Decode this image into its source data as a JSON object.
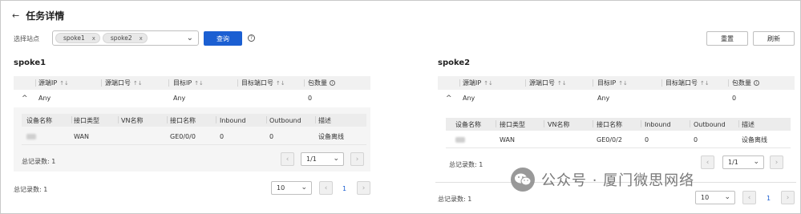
{
  "header": {
    "back_icon": "arrow-left-icon",
    "title": "任务详情"
  },
  "filter": {
    "label": "选择站点",
    "tags": [
      {
        "text": "spoke1",
        "x": "x"
      },
      {
        "text": "spoke2",
        "x": "x"
      }
    ],
    "query_label": "查询",
    "help_glyph": "?",
    "reset_label": "重置",
    "refresh_label": "刷新"
  },
  "columns": {
    "src_ip": "源端IP",
    "src_port": "源端口号",
    "dst_ip": "目标IP",
    "dst_port": "目标端口号",
    "packets": "包数量",
    "sort_glyph": "↑↓",
    "info_glyph": "i"
  },
  "sub_columns": {
    "device": "设备名称",
    "if_type": "接口类型",
    "vn": "VN名称",
    "if_name": "接口名称",
    "inbound": "Inbound",
    "outbound": "Outbound",
    "desc": "描述"
  },
  "panels": [
    {
      "title": "spoke1",
      "row": {
        "src_ip": "Any",
        "dst_ip": "Any",
        "packets": "0"
      },
      "sub_row": {
        "if_type": "WAN",
        "vn": "",
        "if_name": "GE0/0/0",
        "inbound": "0",
        "outbound": "0",
        "desc": "设备离线"
      },
      "sub_total": "总记录数: 1",
      "sub_page": "1/1",
      "total": "总记录数: 1",
      "page_size": "10",
      "page_num": "1"
    },
    {
      "title": "spoke2",
      "row": {
        "src_ip": "Any",
        "dst_ip": "Any",
        "packets": "0"
      },
      "sub_row": {
        "if_type": "WAN",
        "vn": "",
        "if_name": "GE0/0/2",
        "inbound": "0",
        "outbound": "0",
        "desc": "设备离线"
      },
      "sub_total": "总记录数: 1",
      "sub_page": "1/1",
      "total": "总记录数: 1",
      "page_size": "10",
      "page_num": "1"
    }
  ],
  "pager_glyphs": {
    "prev": "‹",
    "next": "›",
    "chevron": "⌄"
  },
  "watermark": {
    "text": "公众号 · 厦门微思网络"
  },
  "colors": {
    "primary": "#1b5fd2"
  }
}
